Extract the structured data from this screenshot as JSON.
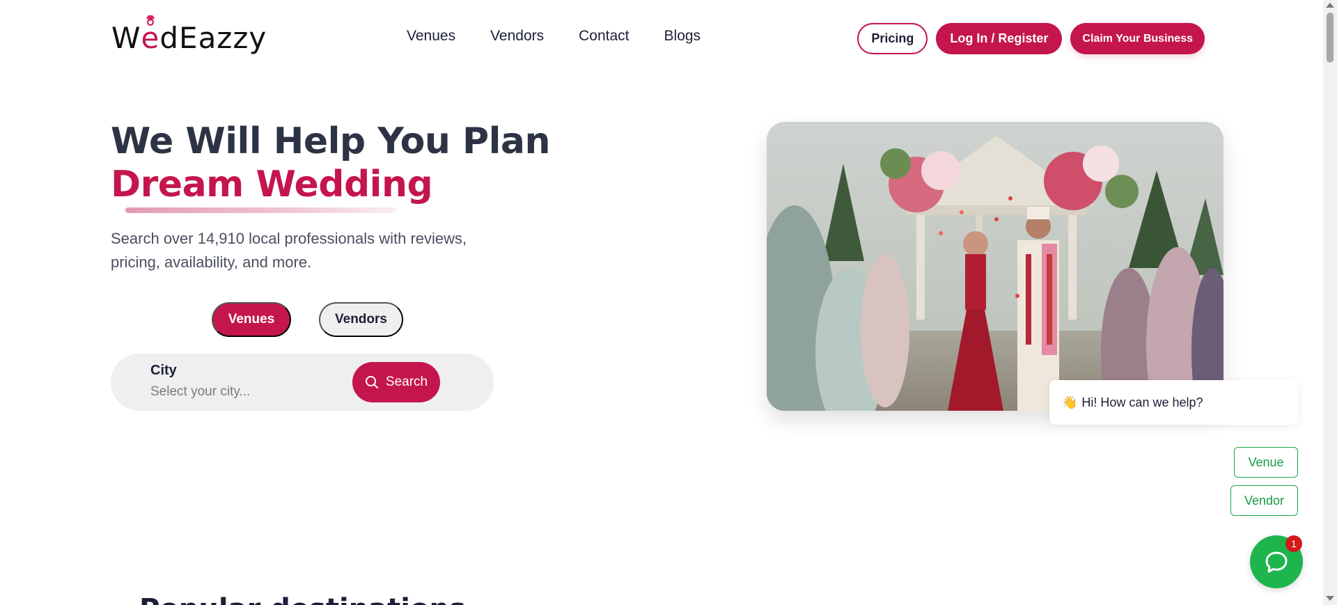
{
  "brand": {
    "logo_text_w": "W",
    "logo_text_e": "e",
    "logo_text_rest": "dEazzy",
    "accent_color": "#c4164d"
  },
  "nav": {
    "items": [
      {
        "label": "Venues"
      },
      {
        "label": "Vendors"
      },
      {
        "label": "Contact"
      },
      {
        "label": "Blogs"
      }
    ]
  },
  "header_actions": {
    "pricing_label": "Pricing",
    "login_label": "Log In / Register",
    "claim_label": "Claim Your Business"
  },
  "hero": {
    "title_line1": "We Will Help You Plan",
    "title_line2": "Dream Wedding",
    "subtitle": "Search over 14,910 local professionals with reviews, pricing, availability, and more.",
    "tabs": [
      {
        "label": "Venues",
        "active": true
      },
      {
        "label": "Vendors",
        "active": false
      }
    ],
    "search": {
      "field_label": "City",
      "placeholder": "Select your city...",
      "button_label": "Search"
    }
  },
  "section": {
    "heading_partial": "Popular destinations"
  },
  "chat": {
    "greeting": "Hi! How can we help?",
    "greeting_icon": "waving-hand-icon",
    "options": [
      {
        "label": "Venue"
      },
      {
        "label": "Vendor"
      }
    ],
    "badge_count": "1",
    "launcher_color": "#1db54c"
  }
}
